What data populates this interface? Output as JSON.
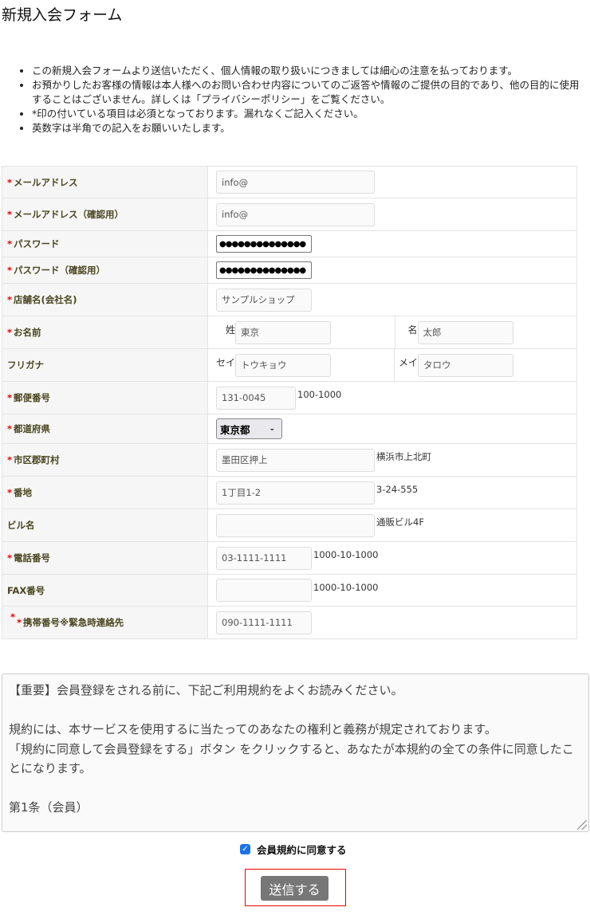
{
  "title": "新規入会フォーム",
  "notes": [
    "この新規入会フォームより送信いただく、個人情報の取り扱いにつきましては細心の注意を払っております。",
    "お預かりしたお客様の情報は本人様へのお問い合わせ内容についてのご返答や情報のご提供の目的であり、他の目的に使用することはございません。詳しくは「プライバシーポリシー」をご覧ください。",
    "*印の付いている項目は必須となっております。漏れなくご記入ください。",
    "英数字は半角での記入をお願いいたします。"
  ],
  "required_mark": "*",
  "fields": {
    "email": {
      "label": "メールアドレス",
      "value": "info@"
    },
    "email_confirm": {
      "label": "メールアドレス（確認用）",
      "value": "info@"
    },
    "password": {
      "label": "パスワード",
      "value": "●●●●●●●●●●●●●●"
    },
    "password_confirm": {
      "label": "パスワード（確認用）",
      "value": "●●●●●●●●●●●●●●"
    },
    "shop": {
      "label": "店舗名(会社名)",
      "value": "サンプルショップ"
    },
    "name": {
      "label": "お名前",
      "sei_label": "姓",
      "sei": "東京",
      "mei_label": "名",
      "mei": "太郎"
    },
    "kana": {
      "label": "フリガナ",
      "sei_label": "セイ",
      "sei": "トウキョウ",
      "mei_label": "メイ",
      "mei": "タロウ"
    },
    "zip": {
      "label": "郵便番号",
      "value": "131-0045",
      "hint": "100-1000"
    },
    "pref": {
      "label": "都道府県",
      "value": "東京都"
    },
    "city": {
      "label": "市区郡町村",
      "value": "墨田区押上",
      "hint": "横浜市上北町"
    },
    "addr": {
      "label": "番地",
      "value": "1丁目1-2",
      "hint": "3-24-555"
    },
    "building": {
      "label": "ビル名",
      "value": "",
      "hint": "通販ビル4F"
    },
    "tel": {
      "label": "電話番号",
      "value": "03-1111-1111",
      "hint": "1000-10-1000"
    },
    "fax": {
      "label": "FAX番号",
      "value": "",
      "hint": "1000-10-1000"
    },
    "mobile": {
      "label": "携帯番号※緊急時連絡先",
      "value": "090-1111-1111"
    }
  },
  "terms": "【重要】会員登録をされる前に、下記ご利用規約をよくお読みください。\n\n規約には、本サービスを使用するに当たってのあなたの権利と義務が規定されております。\n「規約に同意して会員登録をする」ボタン をクリックすると、あなたが本規約の全ての条件に同意したことになります。\n\n第1条（会員）",
  "agree": {
    "label": "会員規約に同意する",
    "checked": true
  },
  "submit": "送信する"
}
